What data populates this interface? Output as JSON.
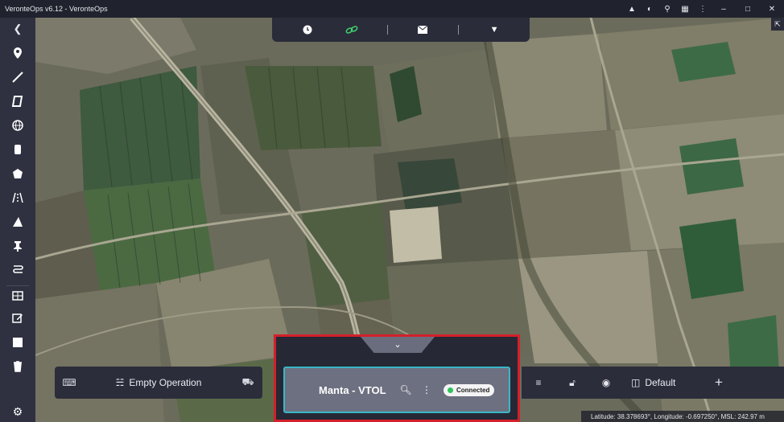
{
  "window": {
    "title": "VeronteOps v6.12 - VeronteOps",
    "controls": [
      "chevron-up-icon",
      "contrast-icon",
      "zoom-icon",
      "puzzle-icon",
      "more-vert-icon",
      "minimize-icon",
      "maximize-icon",
      "close-icon"
    ]
  },
  "toolbar": {
    "items": [
      "collapse-icon",
      "point-icon",
      "line-icon",
      "polygon-icon",
      "globe-icon",
      "cylinder-icon",
      "pentagon-icon",
      "runway-icon",
      "triangle-icon",
      "pin-icon",
      "route-icon",
      "grid-icon",
      "edit-icon",
      "square-icon",
      "trash-icon",
      "settings-icon"
    ]
  },
  "topbar": {
    "items": [
      "clock-icon",
      "link-icon",
      "mail-icon",
      "dropdown-icon"
    ],
    "active_color": "#3fcf6a"
  },
  "operation": {
    "label": "Empty Operation"
  },
  "vehicle": {
    "name": "Manta - VTOL",
    "status": "Connected",
    "status_color": "#2ec45a",
    "highlight_color": "#d3202a",
    "card_border": "#39b7c9"
  },
  "layers": {
    "label": "Default"
  },
  "footer": {
    "coordinates": "Latitude: 38.378693°, Longitude: -0.697250°, MSL: 242.97 m"
  }
}
